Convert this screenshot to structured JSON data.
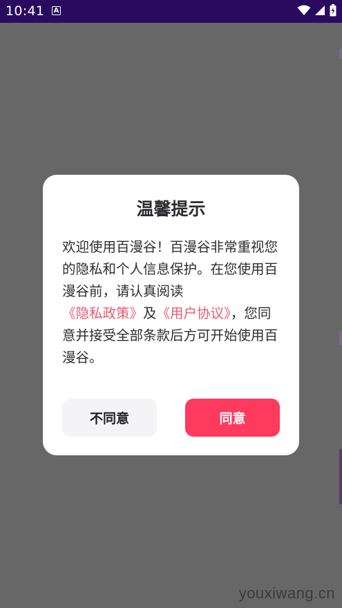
{
  "status_bar": {
    "time": "10:41",
    "notification_letter": "A",
    "icons": [
      "wifi-icon",
      "signal-icon",
      "battery-icon"
    ]
  },
  "dialog": {
    "title": "温馨提示",
    "body": {
      "intro": "欢迎使用百漫谷！百漫谷非常重视您的隐私和个人信息保护。在您使用百漫谷前，请认真阅读",
      "privacy_link": "《隐私政策》",
      "and": "及",
      "agreement_link": "《用户协议》",
      "outro": "，您同意并接受全部条款后方可开始使用百漫谷。"
    },
    "disagree_label": "不同意",
    "agree_label": "同意"
  },
  "watermark": "youxiwang.cn",
  "colors": {
    "status_bar": "#2a0a5e",
    "overlay": "#676767",
    "accent": "#fe3a5f",
    "link": "#e85a72"
  }
}
